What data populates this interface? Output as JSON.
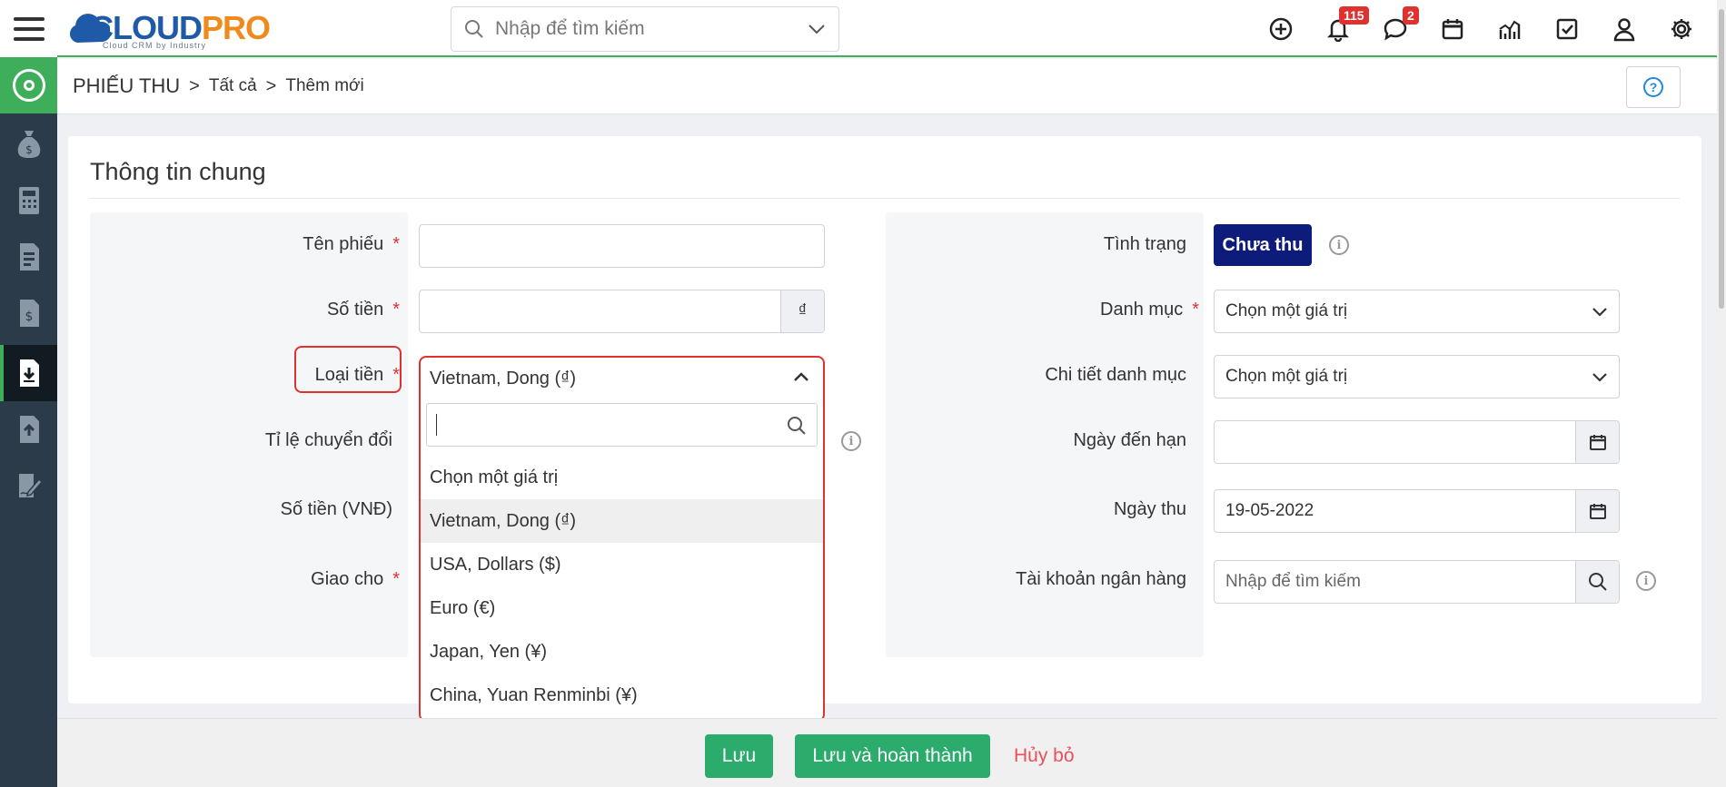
{
  "app": {
    "logo_text_a": "CLOUD",
    "logo_text_b": "PRO",
    "logo_sub": "Cloud CRM by Industry",
    "search_placeholder": "Nhập để tìm kiếm"
  },
  "topbar": {
    "notifications_count": "115",
    "messages_count": "2"
  },
  "breadcrumb": {
    "module": "PHIẾU THU",
    "sep": ">",
    "level1": "Tất cả",
    "level2": "Thêm mới"
  },
  "section": {
    "title": "Thông tin chung"
  },
  "left_form": {
    "ten_phieu_label": "Tên phiếu",
    "so_tien_label": "Số tiền",
    "currency_symbol": "₫",
    "loai_tien_label": "Loại tiền",
    "ti_le_label": "Tỉ lệ chuyển đổi",
    "so_tien_vnd_label": "Số tiền (VNĐ)",
    "giao_cho_label": "Giao cho",
    "required_mark": "*"
  },
  "currency_dropdown": {
    "selected": "Vietnam, Dong (₫)",
    "search_value": "",
    "options": [
      "Chọn một giá trị",
      "Vietnam, Dong (₫)",
      "USA, Dollars ($)",
      "Euro (€)",
      "Japan, Yen (¥)",
      "China, Yuan Renminbi (¥)"
    ]
  },
  "right_form": {
    "tinh_trang_label": "Tình trạng",
    "tinh_trang_value": "Chưa thu",
    "danh_muc_label": "Danh mục",
    "danh_muc_value": "Chọn một giá trị",
    "chi_tiet_label": "Chi tiết danh mục",
    "chi_tiet_value": "Chọn một giá trị",
    "ngay_den_han_label": "Ngày đến hạn",
    "ngay_den_han_value": "",
    "ngay_thu_label": "Ngày thu",
    "ngay_thu_value": "19-05-2022",
    "tai_khoan_label": "Tài khoản ngân hàng",
    "tai_khoan_placeholder": "Nhập để tìm kiếm"
  },
  "footer": {
    "save": "Lưu",
    "save_complete": "Lưu và hoàn thành",
    "cancel": "Hủy bỏ"
  },
  "colors": {
    "sidebar": "#2b3b4a",
    "accent_green": "#3fae5a",
    "status_navy": "#0d1b7a",
    "highlight_red": "#e03131"
  }
}
